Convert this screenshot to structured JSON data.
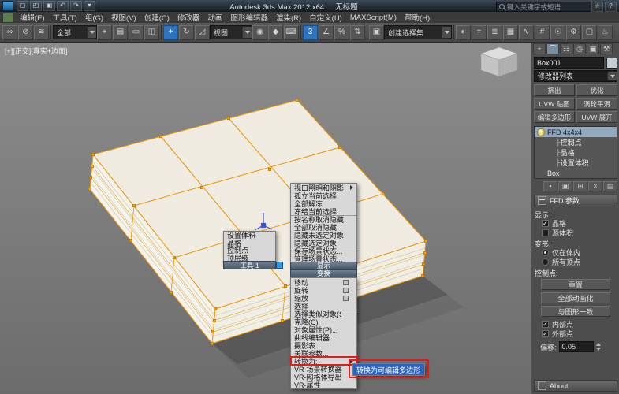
{
  "colors": {
    "selection_orange": "#ef9400",
    "highlight_blue": "#2a63c0",
    "annotation_red": "#e31b1b",
    "quad_center_blue": "#2e9ae8"
  },
  "title_bar": {
    "app_title": "Autodesk 3ds Max 2012 x64",
    "doc_title": "无标题",
    "search_placeholder": "键入关键字或短语",
    "quick_icons": [
      {
        "name": "new-scene-icon",
        "glyph": "▢"
      },
      {
        "name": "open-file-icon",
        "glyph": "◰"
      },
      {
        "name": "save-file-icon",
        "glyph": "▣"
      },
      {
        "name": "undo-icon",
        "glyph": "↶"
      },
      {
        "name": "redo-icon",
        "glyph": "↷"
      },
      {
        "name": "workspace-dropdown-icon",
        "glyph": "▾"
      }
    ],
    "right_icons": [
      {
        "name": "infocenter-star-icon",
        "glyph": "☆"
      },
      {
        "name": "help-icon",
        "glyph": "?"
      }
    ]
  },
  "menu_bar": {
    "items": [
      "编辑(E)",
      "工具(T)",
      "组(G)",
      "视图(V)",
      "创建(C)",
      "修改器",
      "动画",
      "图形编辑器",
      "渲染(R)",
      "自定义(U)",
      "MAXScript(M)",
      "帮助(H)"
    ]
  },
  "toolbar": {
    "filter_value": "全部",
    "coord_value": "视图",
    "named_sets_value": "创建选择集",
    "g1": [
      {
        "name": "select-and-link-icon",
        "glyph": "∞"
      },
      {
        "name": "unlink-selection-icon",
        "glyph": "⊘"
      },
      {
        "name": "bind-to-space-warp-icon",
        "glyph": "≋"
      }
    ],
    "g2": [
      {
        "name": "select-object-icon",
        "glyph": "⌖"
      },
      {
        "name": "select-by-name-icon",
        "glyph": "▤"
      },
      {
        "name": "rectangular-selection-region-icon",
        "glyph": "▭"
      },
      {
        "name": "window-crossing-icon",
        "glyph": "◫"
      }
    ],
    "g3": [
      {
        "name": "select-and-move-icon",
        "glyph": "+",
        "active": true
      },
      {
        "name": "select-and-rotate-icon",
        "glyph": "↻"
      },
      {
        "name": "select-and-scale-icon",
        "glyph": "◿"
      }
    ],
    "g4": [
      {
        "name": "use-pivot-center-icon",
        "glyph": "◉"
      },
      {
        "name": "select-and-manipulate-icon",
        "glyph": "◆"
      },
      {
        "name": "keyboard-override-icon",
        "glyph": "⌨"
      }
    ],
    "g5": [
      {
        "name": "snap-toggle-icon",
        "glyph": "3",
        "active": true
      },
      {
        "name": "angle-snap-icon",
        "glyph": "∠"
      },
      {
        "name": "percent-snap-icon",
        "glyph": "%"
      },
      {
        "name": "spinner-snap-icon",
        "glyph": "⇅"
      }
    ],
    "g6": [
      {
        "name": "edit-named-selection-sets-icon",
        "glyph": "▣"
      }
    ],
    "g7": [
      {
        "name": "mirror-icon",
        "glyph": "◐"
      },
      {
        "name": "align-icon",
        "glyph": "="
      },
      {
        "name": "layer-manager-icon",
        "glyph": "≣"
      },
      {
        "name": "graphite-modeling-icon",
        "glyph": "▦"
      },
      {
        "name": "curve-editor-icon",
        "glyph": "∿"
      },
      {
        "name": "schematic-view-icon",
        "glyph": "#"
      },
      {
        "name": "material-editor-icon",
        "glyph": "☉"
      },
      {
        "name": "render-setup-icon",
        "glyph": "⚙"
      },
      {
        "name": "rendered-frame-icon",
        "glyph": "▢"
      },
      {
        "name": "render-production-icon",
        "glyph": "♨"
      }
    ]
  },
  "viewport": {
    "label_left": "[+][正交][真实+边面]"
  },
  "quad_menu": {
    "tools_title": "工具 1",
    "display_title": "显示",
    "transform_title": "变换",
    "tools_items": [
      {
        "label": "设置体积"
      },
      {
        "label": "晶格"
      },
      {
        "label": "控制点"
      },
      {
        "label": "顶层级"
      }
    ],
    "display_items": [
      {
        "label": "视口照明和阴影",
        "submenu": true
      },
      {
        "label": "孤立当前选择"
      },
      {
        "label": "全部解冻"
      },
      {
        "label": "冻结当前选择"
      },
      {
        "label": "按名称取消隐藏",
        "sep_before": true
      },
      {
        "label": "全部取消隐藏"
      },
      {
        "label": "隐藏未选定对象"
      },
      {
        "label": "隐藏选定对象"
      },
      {
        "label": "保存场景状态...",
        "sep_before": true
      },
      {
        "label": "管理场景状态..."
      }
    ],
    "transform_items": [
      {
        "label": "移动",
        "settings": true
      },
      {
        "label": "旋转",
        "settings": true
      },
      {
        "label": "缩放",
        "settings": true
      },
      {
        "label": "选择"
      },
      {
        "label": "选择类似对象(S)",
        "sep_before": true
      },
      {
        "label": "克隆(C)"
      },
      {
        "label": "对象属性(P)..."
      },
      {
        "label": "曲线编辑器..."
      },
      {
        "label": "摄影表..."
      },
      {
        "label": "关联参数..."
      },
      {
        "label": "转换为:",
        "submenu": true,
        "red": true,
        "sep_before": true
      },
      {
        "label": "VR-场景转换器",
        "sep_before": true
      },
      {
        "label": "VR-网格体导出"
      },
      {
        "label": "VR-属性"
      }
    ],
    "convert_submenu": [
      {
        "label": "转换为可编辑多边形",
        "highlighted": true
      }
    ]
  },
  "command_panel": {
    "tabs": [
      {
        "name": "tab-create",
        "glyph": "+"
      },
      {
        "name": "tab-modify",
        "glyph": "⌒",
        "active": true
      },
      {
        "name": "tab-hierarchy",
        "glyph": "☷"
      },
      {
        "name": "tab-motion",
        "glyph": "◷"
      },
      {
        "name": "tab-display",
        "glyph": "▣"
      },
      {
        "name": "tab-utilities",
        "glyph": "⚒"
      }
    ],
    "object_name": "Box001",
    "modifier_list_label": "修改器列表",
    "modifier_buttons": [
      {
        "label": "挤出"
      },
      {
        "label": "优化"
      },
      {
        "label": "UVW 贴图"
      },
      {
        "label": "涡轮平滑"
      },
      {
        "label": "编辑多边形"
      },
      {
        "label": "UVW 展开"
      }
    ],
    "stack": [
      {
        "label": "FFD 4x4x4",
        "selected": true,
        "bulb": true
      },
      {
        "label": "控制点",
        "indent": true
      },
      {
        "label": "晶格",
        "indent": true
      },
      {
        "label": "设置体积",
        "indent": true
      },
      {
        "label": "Box"
      }
    ],
    "stack_tools": [
      {
        "name": "pin-stack-icon",
        "glyph": "▪"
      },
      {
        "name": "show-end-result-icon",
        "glyph": "▣"
      },
      {
        "name": "make-unique-icon",
        "glyph": "⊞"
      },
      {
        "name": "remove-modifier-icon",
        "glyph": "×"
      },
      {
        "name": "configure-modifier-sets-icon",
        "glyph": "▤"
      }
    ],
    "ffd_rollout": {
      "title": "FFD 参数",
      "display_label": "显示:",
      "display_checks": [
        {
          "label": "晶格",
          "checked": true
        },
        {
          "label": "源体积"
        }
      ],
      "deform_label": "变形:",
      "deform_radios": [
        {
          "label": "仅在体内",
          "selected": true
        },
        {
          "label": "所有顶点"
        }
      ],
      "control_label": "控制点:",
      "control_buttons": [
        {
          "label": "重置"
        },
        {
          "label": "全部动画化"
        },
        {
          "label": "与图形一致"
        }
      ],
      "point_checks": [
        {
          "label": "内部点",
          "checked": true
        },
        {
          "label": "外部点",
          "checked": true
        }
      ],
      "offset_label": "偏移:",
      "offset_value": "0.05",
      "about_title": "About"
    }
  }
}
